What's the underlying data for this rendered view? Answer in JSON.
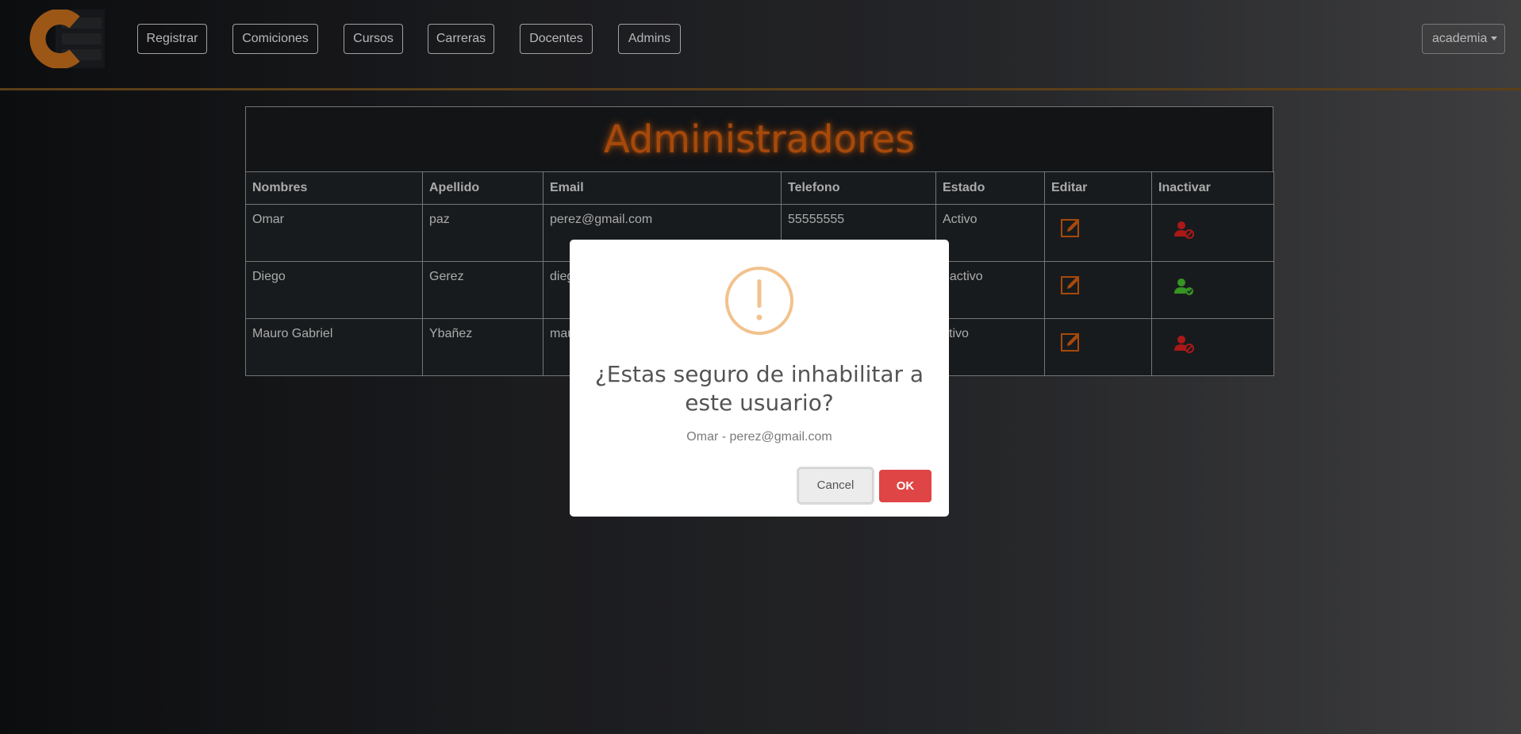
{
  "navbar": {
    "links": [
      "Registrar",
      "Comiciones",
      "Cursos",
      "Carreras",
      "Docentes",
      "Admins"
    ],
    "dropdown_label": "academia"
  },
  "table": {
    "title": "Administradores",
    "headers": [
      "Nombres",
      "Apellido",
      "Email",
      "Telefono",
      "Estado",
      "Editar",
      "Inactivar"
    ],
    "rows": [
      {
        "nombre": "Omar",
        "apellido": "paz",
        "email": "perez@gmail.com",
        "telefono": "55555555",
        "estado": "Activo",
        "action_icon": "user-disable-icon"
      },
      {
        "nombre": "Diego",
        "apellido": "Gerez",
        "email": "dieg",
        "telefono": "",
        "estado": "nactivo",
        "action_icon": "user-enable-icon"
      },
      {
        "nombre": "Mauro Gabriel",
        "apellido": "Ybañez",
        "email": "mau",
        "telefono": "",
        "estado": "ctivo",
        "action_icon": "user-disable-icon"
      }
    ]
  },
  "modal": {
    "title": "¿Estas seguro de inhabilitar a este usuario?",
    "text": "Omar - perez@gmail.com",
    "cancel_label": "Cancel",
    "ok_label": "OK",
    "icon": "warning-icon"
  },
  "colors": {
    "accent_orange": "#c4560e",
    "danger_red": "#e04545",
    "enable_green": "#3fae2a",
    "warning": "#f2c28d"
  }
}
